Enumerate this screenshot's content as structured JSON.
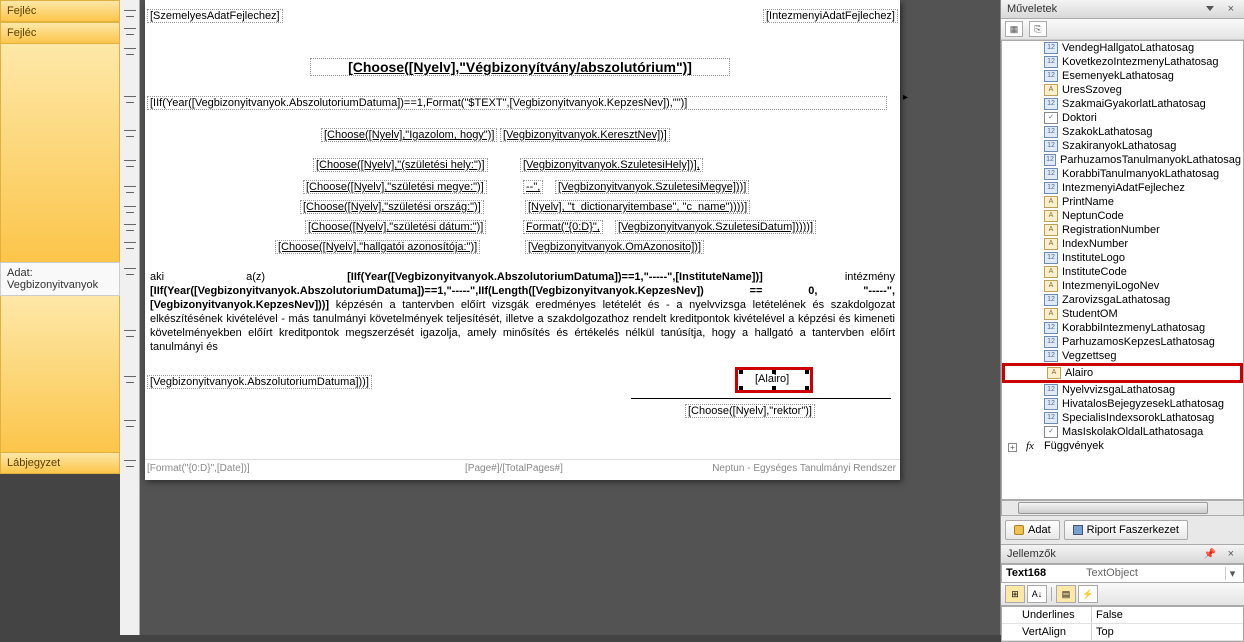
{
  "left": {
    "sections": [
      "Fejléc",
      "Fejléc",
      "Lábjegyzet"
    ],
    "adat_label": "Adat:",
    "adat_value": "Vegbizonyitvanyok"
  },
  "report": {
    "hdr_fields": [
      "[SzemelyesAdatFejlechez]",
      "[IntezmenyiAdatFejlechez]"
    ],
    "title": "[Choose([Nyelv],\"Végbizonyítvány/abszolutórium\")]",
    "line1": "[IIf(Year([Vegbizonyitvanyok.AbszolutoriumDatuma])==1,Format(\"$TEXT\",[Vegbizonyitvanyok.KepzesNev]),\"\")]",
    "ig_l": "[Choose([Nyelv],\"Igazolom, hogy\")]",
    "ig_r": "[Vegbizonyitvanyok.KeresztNev])]",
    "szh_l": "[Choose([Nyelv],\"(születési hely:\")]",
    "szh_r": "[Vegbizonyitvanyok.SzuletesiHely])],",
    "szm_l": "[Choose([Nyelv],\"születési megye:\")]",
    "szm_m": "--\",",
    "szm_r": "[Vegbizonyitvanyok.SzuletesiMegye]))]",
    "szo_l": "[Choose([Nyelv],\"születési ország:\")]",
    "szo_r": "[Nyelv], \"t_dictionaryitembase\", \"c_name\"))))]",
    "szd_l": "[Choose([Nyelv],\"születési dátum:\")]",
    "szd_m": "Format(\"{0:D}\",",
    "szd_r": "[Vegbizonyitvanyok.SzuletesiDatum]))))]",
    "ha_l": "[Choose([Nyelv],\"hallgatói azonosítója:\")]",
    "ha_r": "[Vegbizonyitvanyok.OmAzonosito])]",
    "para_pre": "aki      a(z)      ",
    "para_b1": "[IIf(Year([Vegbizonyitvanyok.AbszolutoriumDatuma])==1,\"-----\",[InstituteName])]",
    "para_mid": "      intézmény ",
    "para_b2": "[IIf(Year([Vegbizonyitvanyok.AbszolutoriumDatuma])==1,\"-----\",IIf(Length([Vegbizonyitvanyok.KepzesNev]) == 0, \"-----\", [Vegbizonyitvanyok.KepzesNev]))]",
    "para_rest": " képzésén a tantervben előírt vizsgák eredményes letételét és - a nyelvvizsga letételének és szakdolgozat elkészítésének kivételével - más tanulmányi követelmények teljesítését, illetve a szakdolgozathoz rendelt kreditpontok kivételével a képzési és kimeneti követelményekben előírt kreditpontok megszerzését igazolja, amely minősítés és értékelés nélkül tanúsítja, hogy a hallgató a tantervben előírt tanulmányi és",
    "absz": "[Vegbizonyitvanyok.AbszolutoriumDatuma]))]",
    "alairo": "[Alairo]",
    "rektor": "[Choose([Nyelv],\"rektor\")]",
    "foot_l": "[Format(\"{0:D}\",[Date])]",
    "foot_c": "[Page#]/[TotalPages#]",
    "foot_r": "Neptun - Egységes Tanulmányi Rendszer"
  },
  "right": {
    "muv_title": "Műveletek",
    "tree_items": [
      {
        "t": "12",
        "n": "VendegHallgatoLathatosag"
      },
      {
        "t": "12",
        "n": "KovetkezoIntezmenyLathatosag"
      },
      {
        "t": "12",
        "n": "EsemenyekLathatosag"
      },
      {
        "t": "A",
        "n": "UresSzoveg"
      },
      {
        "t": "12",
        "n": "SzakmaiGyakorlatLathatosag"
      },
      {
        "t": "c",
        "n": "Doktori"
      },
      {
        "t": "12",
        "n": "SzakokLathatosag"
      },
      {
        "t": "12",
        "n": "SzakiranyokLathatosag"
      },
      {
        "t": "12",
        "n": "ParhuzamosTanulmanyokLathatosag"
      },
      {
        "t": "12",
        "n": "KorabbiTanulmanyokLathatosag"
      },
      {
        "t": "12",
        "n": "IntezmenyiAdatFejlechez"
      },
      {
        "t": "A",
        "n": "PrintName"
      },
      {
        "t": "A",
        "n": "NeptunCode"
      },
      {
        "t": "A",
        "n": "RegistrationNumber"
      },
      {
        "t": "A",
        "n": "IndexNumber"
      },
      {
        "t": "12",
        "n": "InstituteLogo"
      },
      {
        "t": "A",
        "n": "InstituteCode"
      },
      {
        "t": "A",
        "n": "IntezmenyiLogoNev"
      },
      {
        "t": "12",
        "n": "ZarovizsgaLathatosag"
      },
      {
        "t": "A",
        "n": "StudentOM"
      },
      {
        "t": "12",
        "n": "KorabbiIntezmenyLathatosag"
      },
      {
        "t": "12",
        "n": "ParhuzamosKepzesLathatosag"
      },
      {
        "t": "12",
        "n": "Vegzettseg"
      },
      {
        "t": "A",
        "n": "Alairo",
        "hl": true
      },
      {
        "t": "12",
        "n": "NyelvvizsgaLathatosag"
      },
      {
        "t": "12",
        "n": "HivatalosBejegyzesekLathatosag"
      },
      {
        "t": "12",
        "n": "SpecialisIndexsorokLathatosag"
      },
      {
        "t": "c",
        "n": "MasIskolakOldalLathatosaga"
      }
    ],
    "fugg": "Függvények",
    "tab_adat": "Adat",
    "tab_riport": "Riport Faszerkezet",
    "jel_title": "Jellemzők",
    "obj_name": "Text168",
    "obj_type": "TextObject",
    "props": [
      {
        "k": "Underlines",
        "v": "False"
      },
      {
        "k": "VertAlign",
        "v": "Top"
      }
    ]
  }
}
